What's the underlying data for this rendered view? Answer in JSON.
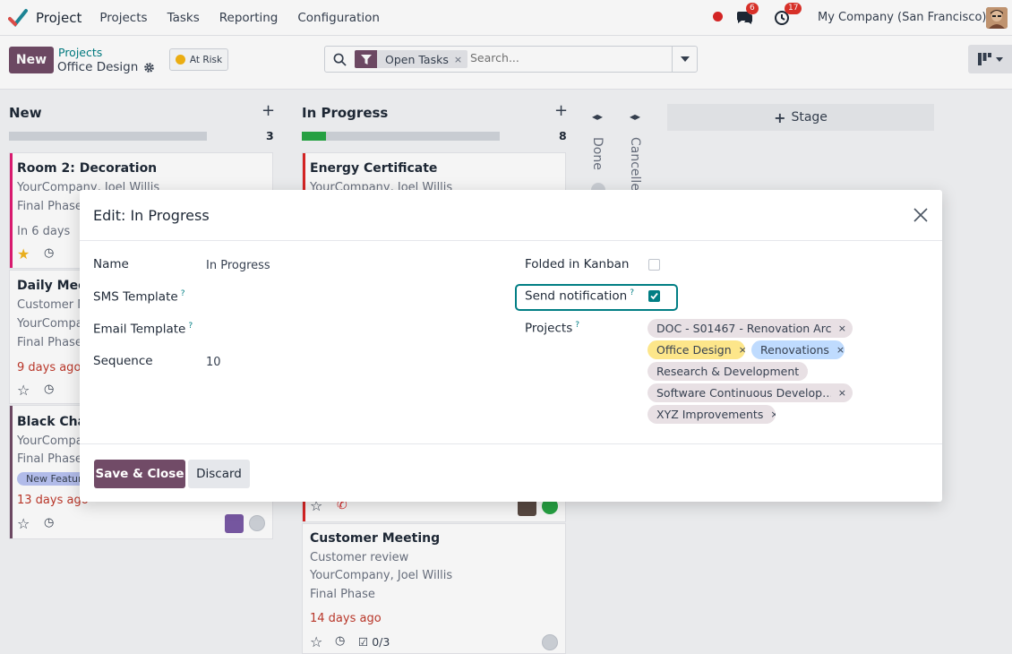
{
  "navbar": {
    "app_name": "Project",
    "menu": [
      "Projects",
      "Tasks",
      "Reporting",
      "Configuration"
    ],
    "chat_count": "6",
    "activity_count": "17",
    "company": "My Company (San Francisco)"
  },
  "control": {
    "new_label": "New",
    "breadcrumb_parent": "Projects",
    "breadcrumb_current": "Office Design",
    "status_label": "At Risk",
    "facet_label": "Open Tasks",
    "facet_remove": "×",
    "search_placeholder": "Search..."
  },
  "columns": {
    "new": {
      "title": "New",
      "add": "+",
      "count": "3",
      "progress": 1.0,
      "cards": [
        {
          "title": "Room 2: Decoration",
          "line1": "YourCompany, Joel Willis",
          "line2": "Final Phase",
          "deadline": "In 6 days"
        },
        {
          "title": "Daily Meeting",
          "line1": "Customer Meeting",
          "line2": "YourCompany",
          "line3": "Final Phase",
          "deadline": "9 days ago"
        },
        {
          "title": "Black Chair",
          "line1": "YourCompany",
          "line2": "Final Phase",
          "tag": "New Feature",
          "deadline": "13 days ago"
        }
      ]
    },
    "in_progress": {
      "title": "In Progress",
      "add": "+",
      "count": "8",
      "progress": 0.12,
      "cards": [
        {
          "title": "Energy Certificate",
          "line1": "YourCompany, Joel Willis"
        },
        {
          "title": "Customer Meeting",
          "line1": "Customer review",
          "line2": "YourCompany, Joel Willis",
          "line3": "Final Phase",
          "deadline": "14 days ago",
          "checklist": "0/3"
        }
      ]
    },
    "folded": [
      {
        "title": "Done"
      },
      {
        "title": "Cancelled"
      }
    ],
    "add_stage": "Stage"
  },
  "modal": {
    "title": "Edit: In Progress",
    "fields": {
      "name_label": "Name",
      "name_value": "In Progress",
      "sms_label": "SMS Template",
      "email_label": "Email Template",
      "sequence_label": "Sequence",
      "sequence_value": "10",
      "folded_label": "Folded in Kanban",
      "notify_label": "Send notification",
      "projects_label": "Projects",
      "help": "?"
    },
    "folded_checked": false,
    "notify_checked": true,
    "projects": [
      {
        "name": "DOC - S01467 - Renovation Arc…",
        "color": "default"
      },
      {
        "name": "Office Design",
        "color": "yellow"
      },
      {
        "name": "Renovations",
        "color": "blue"
      },
      {
        "name": "Research & Development",
        "color": "default"
      },
      {
        "name": "Software Continuous Develop…",
        "color": "default"
      },
      {
        "name": "XYZ Improvements",
        "color": "default"
      }
    ],
    "tag_remove": "×",
    "save_label": "Save & Close",
    "discard_label": "Discard"
  },
  "colors": {
    "brand": "#714b67",
    "accent": "#017e84",
    "success": "#28a745",
    "danger": "#c0392b"
  }
}
